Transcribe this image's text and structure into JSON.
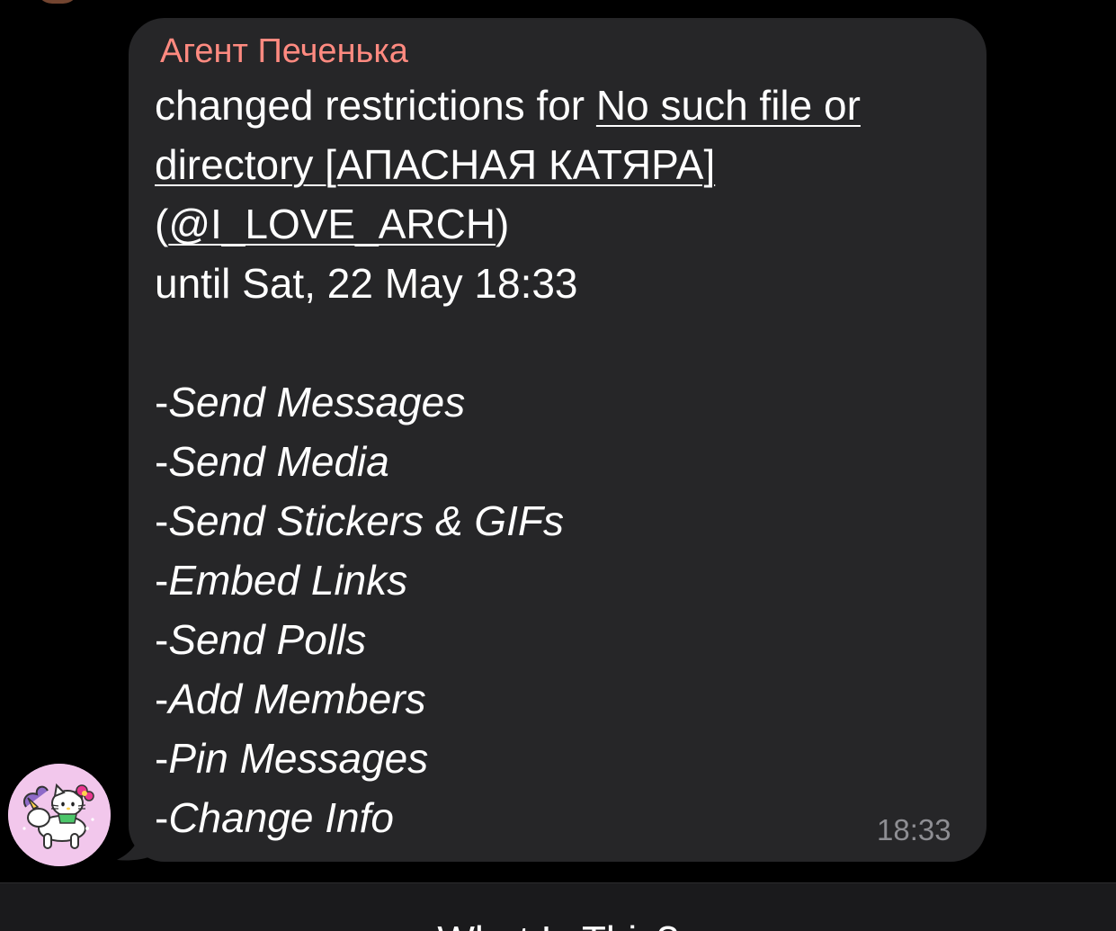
{
  "message": {
    "sender": "Агент Печенька",
    "intro": "changed restrictions for ",
    "target_line1": "No such file or ",
    "target_line2": "directory [АПАСНАЯ КАТЯРА]",
    "handle_open": "(",
    "handle": "@I_LOVE_ARCH",
    "handle_close": ")",
    "until": "until Sat, 22 May 18:33",
    "permissions": [
      "Send Messages",
      "Send Media",
      "Send Stickers & GIFs",
      "Embed Links",
      "Send Polls",
      "Add Members",
      "Pin Messages",
      "Change Info"
    ],
    "time": "18:33"
  },
  "bottom_bar": {
    "text": "What Is This?"
  },
  "colors": {
    "background": "#000000",
    "bubble": "#262628",
    "sender": "#ff8a80",
    "timestamp": "#8e8e93",
    "avatar_bg": "#f2c7ec"
  }
}
